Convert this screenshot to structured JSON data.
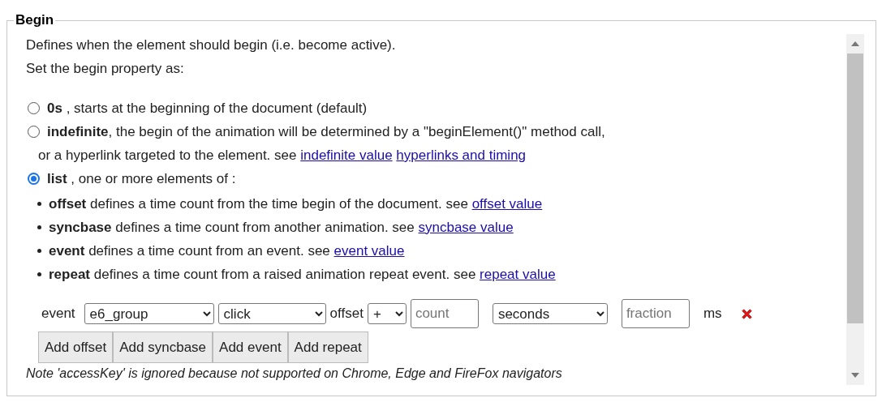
{
  "legend": "Begin",
  "intro": [
    "Defines when the element should begin (i.e. become active).",
    "Set the begin property as:"
  ],
  "options": [
    {
      "text": "**0s** , starts at the beginning of the document (default)",
      "selected": false
    },
    {
      "text": "**indefinite**, the begin of the animation will be determined by a \"beginElement()\" method call,",
      "selected": false,
      "continuation": "or a hyperlink targeted to the element. see",
      "links": [
        "indefinite value",
        "hyperlinks and timing"
      ]
    },
    {
      "text": "**list** , one or more elements of :",
      "selected": true
    }
  ],
  "bullets": [
    {
      "text": "**offset** defines a time count from the time begin of the document. see",
      "link": "offset value"
    },
    {
      "text": "**syncbase** defines a time count from another animation. see",
      "link": "syncbase value"
    },
    {
      "text": "**event** defines a time count from an event. see",
      "link": "event value"
    },
    {
      "text": "**repeat** defines a time count from a raised animation repeat event. see",
      "link": "repeat value"
    }
  ],
  "event_row": {
    "label": "event",
    "element": "e6_group",
    "event": "click",
    "offset_label": "offset",
    "sign": "+",
    "count_placeholder": "count",
    "unit": "seconds",
    "fraction_placeholder": "fraction",
    "ms_label": "ms"
  },
  "buttons": [
    "Add offset",
    "Add syncbase",
    "Add event",
    "Add repeat"
  ],
  "note": "Note 'accessKey' is ignored because not supported on Chrome, Edge and FireFox navigators"
}
